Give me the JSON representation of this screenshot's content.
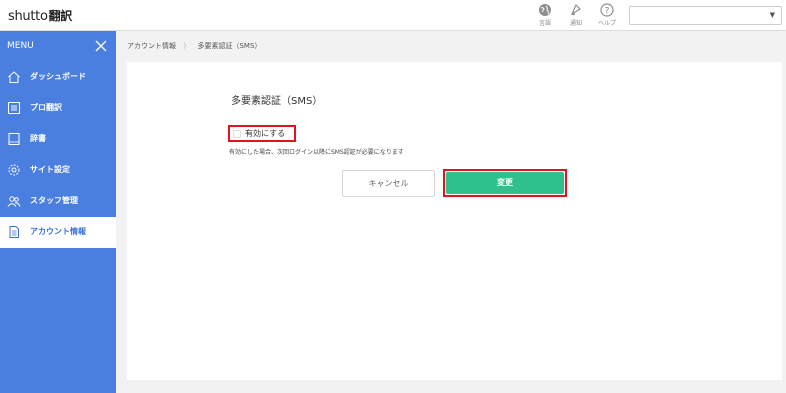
{
  "app": {
    "logo_brand": "shutto",
    "logo_suffix": "翻訳"
  },
  "topbar": {
    "icons": [
      {
        "name": "globe-icon",
        "label": "言語"
      },
      {
        "name": "bell-icon",
        "label": "通知"
      },
      {
        "name": "help-icon",
        "label": "ヘルプ"
      }
    ],
    "account_select_value": ""
  },
  "sidebar": {
    "menu_label": "MENU",
    "items": [
      {
        "label": "ダッシュボード",
        "icon": "home-icon",
        "active": false
      },
      {
        "label": "プロ翻訳",
        "icon": "grid-icon",
        "active": false
      },
      {
        "label": "辞書",
        "icon": "book-icon",
        "active": false
      },
      {
        "label": "サイト設定",
        "icon": "gear-icon",
        "active": false
      },
      {
        "label": "スタッフ管理",
        "icon": "staff-icon",
        "active": false
      },
      {
        "label": "アカウント情報",
        "icon": "document-icon",
        "active": true
      }
    ]
  },
  "breadcrumb": {
    "parent": "アカウント情報",
    "separator": "〉",
    "current": "多要素認証（SMS）"
  },
  "main": {
    "title": "多要素認証（SMS）",
    "checkbox_label": "有効にする",
    "checkbox_checked": false,
    "note": "有効にした場合、次回ログイン以降にSMS認証が必要になります",
    "cancel_label": "キャンセル",
    "submit_label": "変更"
  },
  "colors": {
    "sidebar": "#4a7fe0",
    "accent_green": "#2fc18b",
    "highlight_red": "#e0141e"
  }
}
